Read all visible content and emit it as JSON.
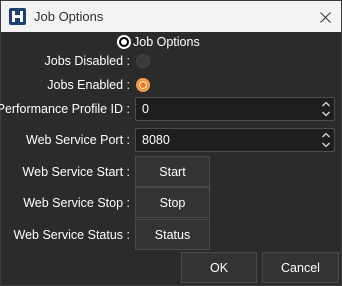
{
  "window": {
    "title": "Job Options"
  },
  "group": {
    "title": "Job Options"
  },
  "fields": {
    "jobs_disabled": {
      "label": "Jobs Disabled :",
      "checked": false
    },
    "jobs_enabled": {
      "label": "Jobs Enabled :",
      "checked": true
    },
    "performance_profile_id": {
      "label": "Performance Profile ID :",
      "value": "0"
    },
    "web_service_port": {
      "label": "Web Service Port :",
      "value": "8080"
    },
    "web_service_start": {
      "label": "Web Service Start :",
      "button": "Start"
    },
    "web_service_stop": {
      "label": "Web Service Stop :",
      "button": "Stop"
    },
    "web_service_status": {
      "label": "Web Service Status :",
      "button": "Status"
    }
  },
  "footer": {
    "ok": "OK",
    "cancel": "Cancel"
  },
  "colors": {
    "accent": "#f07a20",
    "background": "#2b2b2b",
    "titlebar": "#f3f3f3"
  }
}
